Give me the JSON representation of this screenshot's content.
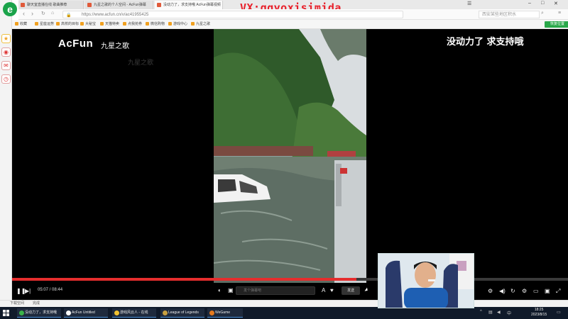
{
  "browser": {
    "watermark": "VX:ggyoxisimida",
    "tabs": [
      {
        "label": "聊天室直播在线 歌曲推荐"
      },
      {
        "label": "九星之歌的个人空间 - AcFun弹幕"
      },
      {
        "label": "没动力了，求支持哦 AcFun弹幕视频"
      }
    ],
    "address": {
      "url": "https://www.acfun.cn/v/ac41955425",
      "search_placeholder": "西安某些地区积水"
    },
    "bookmarks": [
      "收藏",
      "星座运势",
      "高校的目标",
      "大秘宝",
      "天猫特卖",
      "点我抢券",
      "微信购物",
      "游戏中心",
      "九星之歌"
    ],
    "restore_label": "恢复位置",
    "status_left": "下载空间",
    "status_right": "完成"
  },
  "player": {
    "brand": "AcFun",
    "channel": "九星之歌",
    "channel_ghost": "九星之歌",
    "right_caption": "没动力了 求支持哦",
    "time_current": "05:07",
    "time_total": "08:44",
    "progress_fraction": 0.62,
    "danmu_placeholder": "发个弹幕吧",
    "send_label": "发送"
  },
  "taskbar": {
    "apps": [
      {
        "label": "没动力了，求支持哦",
        "color": "#3bb34a"
      },
      {
        "label": "AcFun Untitled",
        "color": "#ffffff"
      },
      {
        "label": "游戏风云人 - 在线",
        "color": "#f2c230"
      },
      {
        "label": "League of Legends",
        "color": "#c8a040"
      },
      {
        "label": "WeGame",
        "color": "#e67a1e"
      }
    ],
    "time": "18:25",
    "date": "2023/8/15"
  },
  "colors": {
    "accent": "#e52d2d",
    "browser_brand": "#1aa34a",
    "watermark": "#e8202a"
  },
  "icons": [
    "play-icon",
    "next-icon",
    "volume-icon",
    "fullscreen-icon",
    "settings-icon",
    "danmu-toggle-icon",
    "search-icon",
    "back-icon",
    "forward-icon",
    "refresh-icon",
    "home-icon"
  ]
}
